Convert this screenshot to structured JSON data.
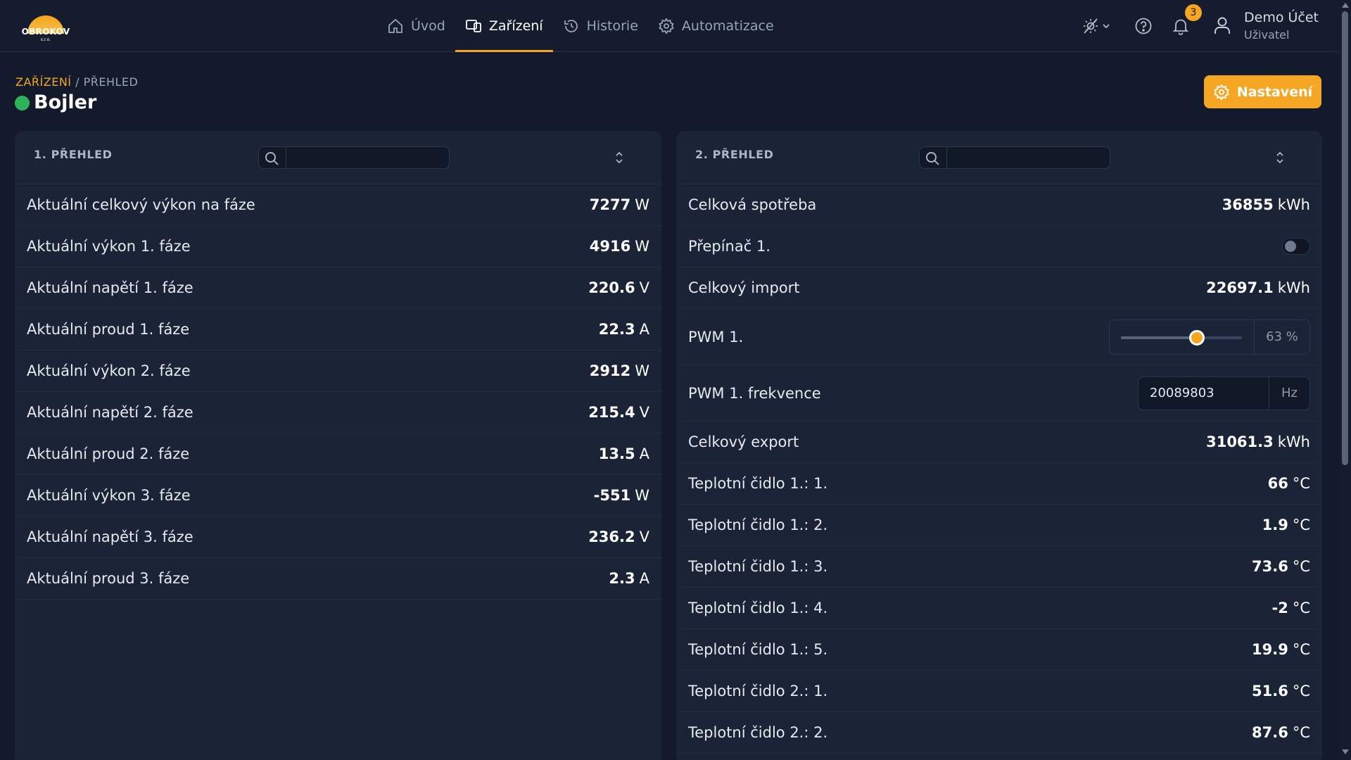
{
  "brand": {
    "name": "OBROKOV",
    "suffix": "s.r.o."
  },
  "nav": {
    "items": [
      {
        "label": "Úvod",
        "icon": "home-icon",
        "active": false
      },
      {
        "label": "Zařízení",
        "icon": "devices-icon",
        "active": true
      },
      {
        "label": "Historie",
        "icon": "history-icon",
        "active": false
      },
      {
        "label": "Automatizace",
        "icon": "gear-icon",
        "active": false
      }
    ]
  },
  "header": {
    "notifications_count": "3",
    "user": {
      "name": "Demo Účet",
      "role": "Uživatel"
    }
  },
  "breadcrumb": {
    "link": "ZAŘÍZENÍ",
    "separator": " / ",
    "current": "PŘEHLED"
  },
  "page": {
    "title": "Bojler",
    "status_color": "#2fb35a",
    "settings_label": "Nastavení"
  },
  "colors": {
    "accent": "#f5a623",
    "background": "#131a2b",
    "panel": "#1b2336"
  },
  "panel_left": {
    "title": "1. PŘEHLED",
    "search_placeholder": "",
    "rows": [
      {
        "label": "Aktuální celkový výkon na fáze",
        "value": "7277",
        "unit": "W"
      },
      {
        "label": "Aktuální výkon 1. fáze",
        "value": "4916",
        "unit": "W"
      },
      {
        "label": "Aktuální napětí 1. fáze",
        "value": "220.6",
        "unit": "V"
      },
      {
        "label": "Aktuální proud 1. fáze",
        "value": "22.3",
        "unit": "A"
      },
      {
        "label": "Aktuální výkon 2. fáze",
        "value": "2912",
        "unit": "W"
      },
      {
        "label": "Aktuální napětí 2. fáze",
        "value": "215.4",
        "unit": "V"
      },
      {
        "label": "Aktuální proud 2. fáze",
        "value": "13.5",
        "unit": "A"
      },
      {
        "label": "Aktuální výkon 3. fáze",
        "value": "-551",
        "unit": "W"
      },
      {
        "label": "Aktuální napětí 3. fáze",
        "value": "236.2",
        "unit": "V"
      },
      {
        "label": "Aktuální proud 3. fáze",
        "value": "2.3",
        "unit": "A"
      }
    ]
  },
  "panel_right": {
    "title": "2. PŘEHLED",
    "search_placeholder": "",
    "rows": [
      {
        "label": "Celková spotřeba",
        "value": "36855",
        "unit": "kWh"
      },
      {
        "label": "Přepínač 1.",
        "toggle": false
      },
      {
        "label": "Celkový import",
        "value": "22697.1",
        "unit": "kWh"
      },
      {
        "label": "PWM 1.",
        "slider_value": 63,
        "slider_text": "63 %"
      },
      {
        "label": "PWM 1. frekvence",
        "input_value": "20089803",
        "unit": "Hz"
      },
      {
        "label": "Celkový export",
        "value": "31061.3",
        "unit": "kWh"
      },
      {
        "label": "Teplotní čidlo 1.: 1.",
        "value": "66",
        "unit": "°C"
      },
      {
        "label": "Teplotní čidlo 1.: 2.",
        "value": "1.9",
        "unit": "°C"
      },
      {
        "label": "Teplotní čidlo 1.: 3.",
        "value": "73.6",
        "unit": "°C"
      },
      {
        "label": "Teplotní čidlo 1.: 4.",
        "value": "-2",
        "unit": "°C"
      },
      {
        "label": "Teplotní čidlo 1.: 5.",
        "value": "19.9",
        "unit": "°C"
      },
      {
        "label": "Teplotní čidlo 2.: 1.",
        "value": "51.6",
        "unit": "°C"
      },
      {
        "label": "Teplotní čidlo 2.: 2.",
        "value": "87.6",
        "unit": "°C"
      }
    ]
  }
}
